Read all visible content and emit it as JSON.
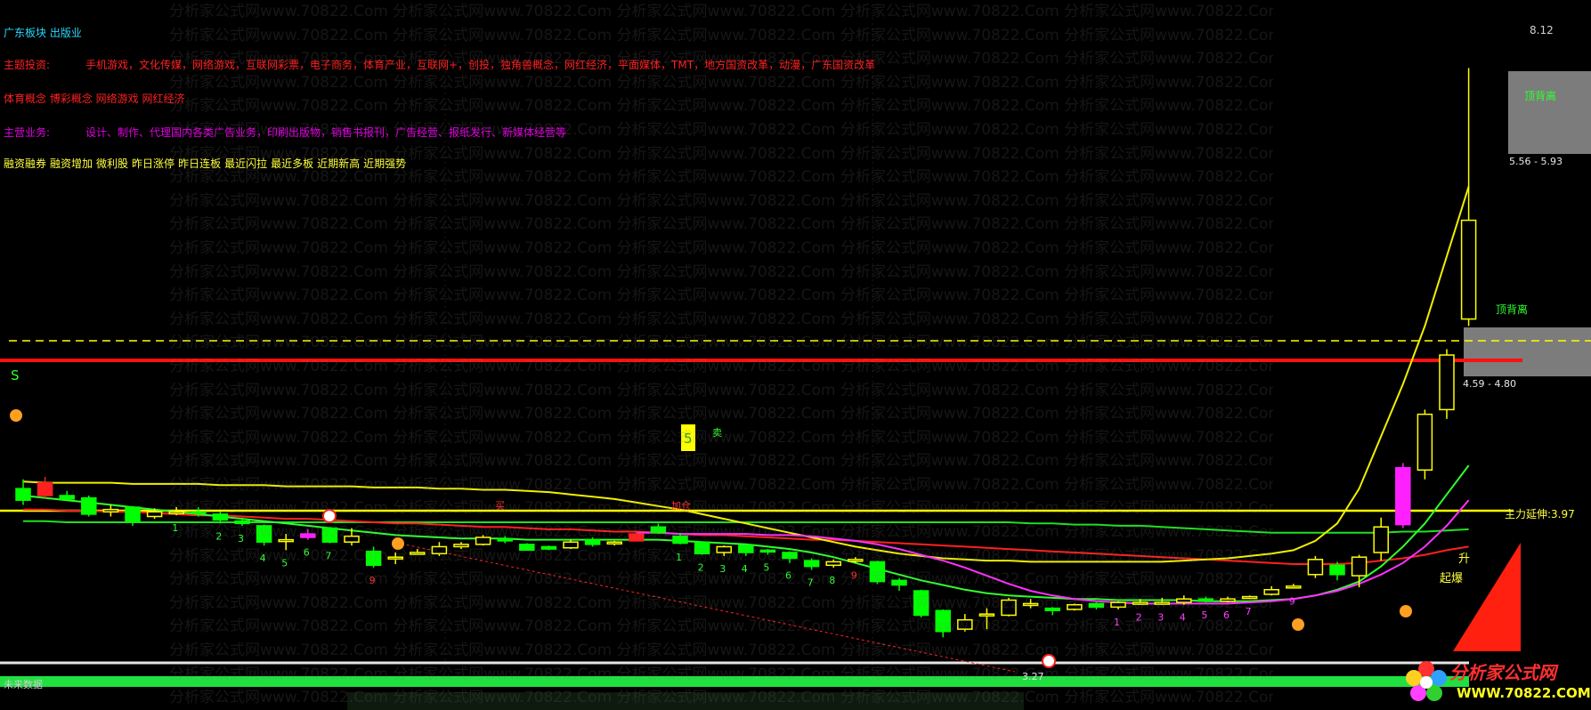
{
  "info": {
    "sector": "广东板块 出版业",
    "theme_key": "主题投资:",
    "theme_val": "手机游戏，文化传媒，网络游戏，互联网彩票，电子商务，体育产业，互联网+，创投，独角兽概念，网红经济，平面媒体，TMT，地方国资改革，动漫，广东国资改革",
    "concept": "体育概念 博彩概念 网络游戏 网红经济",
    "biz_key": "主营业务:",
    "biz_val": "设计、制作、代理国内各类广告业务，印刷出版物，销售书报刊，广告经营、报纸发行、新媒体经营等",
    "tags": [
      "融资融券",
      "融资增加",
      "微利股",
      "昨日涨停",
      "昨日连板",
      "最近闪拉",
      "最近多板",
      "近期新高",
      "近期强势"
    ]
  },
  "watermark": "分析家公式网www.70822.Com",
  "bottom_label": "未来数据",
  "logo": {
    "cn": "分析家公式网",
    "url": "WWW.70822.COM"
  },
  "colors": {
    "up": "#ffff00",
    "down": "#00ff00",
    "bg": "#000000",
    "accent": "#ff2020"
  },
  "chart_data": {
    "type": "candlestick",
    "annotations": {
      "top_price": "8.12",
      "zone_high": "5.56 - 5.93",
      "zone_mid": "4.59 - 4.80",
      "low_price": "3.27",
      "extend": "主力延伸:3.97",
      "divergence1": "顶背离",
      "divergence2": "顶背离",
      "surge": "起爆",
      "rise": "升",
      "buy": "买",
      "sell": "卖",
      "add": "加仓",
      "s_mark": "S",
      "five": "5"
    },
    "counts": [
      {
        "i": 7,
        "t": "1"
      },
      {
        "i": 9,
        "t": "2"
      },
      {
        "i": 10,
        "t": "3"
      },
      {
        "i": 11,
        "t": "4"
      },
      {
        "i": 12,
        "t": "5"
      },
      {
        "i": 13,
        "t": "6"
      },
      {
        "i": 14,
        "t": "7"
      },
      {
        "i": 16,
        "t": "9"
      },
      {
        "i": 30,
        "t": "1"
      },
      {
        "i": 31,
        "t": "2"
      },
      {
        "i": 32,
        "t": "3"
      },
      {
        "i": 33,
        "t": "4"
      },
      {
        "i": 34,
        "t": "5"
      },
      {
        "i": 35,
        "t": "6"
      },
      {
        "i": 36,
        "t": "7"
      },
      {
        "i": 37,
        "t": "8"
      },
      {
        "i": 38,
        "t": "9"
      },
      {
        "i": 50,
        "t": "1"
      },
      {
        "i": 51,
        "t": "2"
      },
      {
        "i": 52,
        "t": "3"
      },
      {
        "i": 53,
        "t": "4"
      },
      {
        "i": 54,
        "t": "5"
      },
      {
        "i": 55,
        "t": "6"
      },
      {
        "i": 56,
        "t": "7"
      },
      {
        "i": 58,
        "t": "9"
      }
    ],
    "candles": [
      {
        "o": 4.5,
        "c": 4.4,
        "h": 4.58,
        "l": 4.36
      },
      {
        "o": 4.55,
        "c": 4.44,
        "h": 4.6,
        "l": 4.42
      },
      {
        "o": 4.44,
        "c": 4.41,
        "h": 4.48,
        "l": 4.4
      },
      {
        "o": 4.42,
        "c": 4.28,
        "h": 4.44,
        "l": 4.26
      },
      {
        "o": 4.3,
        "c": 4.32,
        "h": 4.36,
        "l": 4.26
      },
      {
        "o": 4.34,
        "c": 4.22,
        "h": 4.35,
        "l": 4.18
      },
      {
        "o": 4.26,
        "c": 4.3,
        "h": 4.33,
        "l": 4.24
      },
      {
        "o": 4.3,
        "c": 4.3,
        "h": 4.34,
        "l": 4.27
      },
      {
        "o": 4.3,
        "c": 4.29,
        "h": 4.34,
        "l": 4.26
      },
      {
        "o": 4.28,
        "c": 4.23,
        "h": 4.3,
        "l": 4.2
      },
      {
        "o": 4.22,
        "c": 4.2,
        "h": 4.25,
        "l": 4.18
      },
      {
        "o": 4.18,
        "c": 4.04,
        "h": 4.19,
        "l": 4.01
      },
      {
        "o": 4.06,
        "c": 4.06,
        "h": 4.11,
        "l": 3.97
      },
      {
        "o": 4.08,
        "c": 4.11,
        "h": 4.15,
        "l": 4.06
      },
      {
        "o": 4.16,
        "c": 4.04,
        "h": 4.17,
        "l": 4.03
      },
      {
        "o": 4.04,
        "c": 4.09,
        "h": 4.16,
        "l": 4.01
      },
      {
        "o": 3.96,
        "c": 3.84,
        "h": 4.0,
        "l": 3.82
      },
      {
        "o": 3.91,
        "c": 3.91,
        "h": 3.95,
        "l": 3.85
      },
      {
        "o": 3.95,
        "c": 3.95,
        "h": 3.98,
        "l": 3.94
      },
      {
        "o": 3.94,
        "c": 4.0,
        "h": 4.04,
        "l": 3.92
      },
      {
        "o": 4.0,
        "c": 4.02,
        "h": 4.04,
        "l": 3.98
      },
      {
        "o": 4.02,
        "c": 4.08,
        "h": 4.1,
        "l": 4.01
      },
      {
        "o": 4.07,
        "c": 4.05,
        "h": 4.09,
        "l": 4.03
      },
      {
        "o": 4.02,
        "c": 3.97,
        "h": 4.03,
        "l": 3.97
      },
      {
        "o": 4.0,
        "c": 3.98,
        "h": 4.01,
        "l": 3.97
      },
      {
        "o": 3.99,
        "c": 4.04,
        "h": 4.06,
        "l": 3.98
      },
      {
        "o": 4.06,
        "c": 4.02,
        "h": 4.08,
        "l": 4.0
      },
      {
        "o": 4.03,
        "c": 4.04,
        "h": 4.05,
        "l": 4.01
      },
      {
        "o": 4.05,
        "c": 4.11,
        "h": 4.13,
        "l": 4.05
      },
      {
        "o": 4.17,
        "c": 4.12,
        "h": 4.2,
        "l": 4.11
      },
      {
        "o": 4.09,
        "c": 4.03,
        "h": 4.12,
        "l": 4.02
      },
      {
        "o": 4.04,
        "c": 3.94,
        "h": 4.04,
        "l": 3.93
      },
      {
        "o": 3.95,
        "c": 4.0,
        "h": 4.01,
        "l": 3.92
      },
      {
        "o": 4.01,
        "c": 3.95,
        "h": 4.01,
        "l": 3.92
      },
      {
        "o": 3.97,
        "c": 3.96,
        "h": 3.98,
        "l": 3.93
      },
      {
        "o": 3.95,
        "c": 3.9,
        "h": 3.96,
        "l": 3.86
      },
      {
        "o": 3.88,
        "c": 3.83,
        "h": 3.9,
        "l": 3.8
      },
      {
        "o": 3.84,
        "c": 3.87,
        "h": 3.89,
        "l": 3.82
      },
      {
        "o": 3.88,
        "c": 3.89,
        "h": 3.91,
        "l": 3.86
      },
      {
        "o": 3.87,
        "c": 3.7,
        "h": 3.88,
        "l": 3.68
      },
      {
        "o": 3.71,
        "c": 3.67,
        "h": 3.73,
        "l": 3.62
      },
      {
        "o": 3.62,
        "c": 3.41,
        "h": 3.63,
        "l": 3.39
      },
      {
        "o": 3.45,
        "c": 3.27,
        "h": 3.46,
        "l": 3.22
      },
      {
        "o": 3.29,
        "c": 3.37,
        "h": 3.42,
        "l": 3.27
      },
      {
        "o": 3.42,
        "c": 3.42,
        "h": 3.47,
        "l": 3.29
      },
      {
        "o": 3.41,
        "c": 3.54,
        "h": 3.56,
        "l": 3.4
      },
      {
        "o": 3.51,
        "c": 3.51,
        "h": 3.55,
        "l": 3.47
      },
      {
        "o": 3.47,
        "c": 3.45,
        "h": 3.48,
        "l": 3.41
      },
      {
        "o": 3.46,
        "c": 3.5,
        "h": 3.51,
        "l": 3.45
      },
      {
        "o": 3.51,
        "c": 3.48,
        "h": 3.52,
        "l": 3.46
      },
      {
        "o": 3.48,
        "c": 3.52,
        "h": 3.53,
        "l": 3.46
      },
      {
        "o": 3.51,
        "c": 3.52,
        "h": 3.55,
        "l": 3.5
      },
      {
        "o": 3.52,
        "c": 3.52,
        "h": 3.56,
        "l": 3.5
      },
      {
        "o": 3.52,
        "c": 3.55,
        "h": 3.58,
        "l": 3.5
      },
      {
        "o": 3.55,
        "c": 3.53,
        "h": 3.57,
        "l": 3.52
      },
      {
        "o": 3.53,
        "c": 3.55,
        "h": 3.57,
        "l": 3.52
      },
      {
        "o": 3.56,
        "c": 3.57,
        "h": 3.58,
        "l": 3.55
      },
      {
        "o": 3.59,
        "c": 3.63,
        "h": 3.66,
        "l": 3.58
      },
      {
        "o": 3.65,
        "c": 3.66,
        "h": 3.68,
        "l": 3.64
      },
      {
        "o": 3.76,
        "c": 3.89,
        "h": 3.92,
        "l": 3.73
      },
      {
        "o": 3.84,
        "c": 3.76,
        "h": 3.87,
        "l": 3.71
      },
      {
        "o": 3.75,
        "c": 3.91,
        "h": 3.93,
        "l": 3.65
      },
      {
        "o": 3.95,
        "c": 4.17,
        "h": 4.25,
        "l": 3.88
      },
      {
        "o": 4.19,
        "c": 4.68,
        "h": 4.72,
        "l": 4.16
      },
      {
        "o": 4.66,
        "c": 5.14,
        "h": 5.18,
        "l": 4.58
      },
      {
        "o": 5.18,
        "c": 5.65,
        "h": 5.7,
        "l": 5.1
      },
      {
        "o": 5.96,
        "c": 6.81,
        "h": 8.12,
        "l": 5.9
      }
    ],
    "ma_green": [
      4.22,
      4.22,
      4.21,
      4.21,
      4.21,
      4.21,
      4.21,
      4.21,
      4.21,
      4.21,
      4.21,
      4.21,
      4.21,
      4.21,
      4.21,
      4.21,
      4.21,
      4.21,
      4.21,
      4.21,
      4.21,
      4.21,
      4.21,
      4.21,
      4.21,
      4.21,
      4.21,
      4.21,
      4.21,
      4.21,
      4.21,
      4.21,
      4.21,
      4.21,
      4.21,
      4.21,
      4.21,
      4.21,
      4.21,
      4.21,
      4.21,
      4.21,
      4.21,
      4.21,
      4.21,
      4.21,
      4.2,
      4.2,
      4.19,
      4.19,
      4.18,
      4.18,
      4.17,
      4.16,
      4.15,
      4.14,
      4.13,
      4.12,
      4.12,
      4.12,
      4.12,
      4.12,
      4.12,
      4.13,
      4.13,
      4.14,
      4.15
    ],
    "ma_red": [
      4.32,
      4.32,
      4.31,
      4.31,
      4.3,
      4.3,
      4.29,
      4.28,
      4.27,
      4.27,
      4.26,
      4.25,
      4.24,
      4.24,
      4.23,
      4.22,
      4.21,
      4.2,
      4.2,
      4.19,
      4.18,
      4.17,
      4.17,
      4.16,
      4.15,
      4.15,
      4.14,
      4.13,
      4.13,
      4.12,
      4.11,
      4.1,
      4.1,
      4.09,
      4.08,
      4.07,
      4.06,
      4.06,
      4.05,
      4.04,
      4.03,
      4.02,
      4.01,
      4.0,
      3.99,
      3.98,
      3.97,
      3.96,
      3.95,
      3.94,
      3.93,
      3.92,
      3.91,
      3.9,
      3.89,
      3.88,
      3.87,
      3.86,
      3.85,
      3.85,
      3.85,
      3.86,
      3.88,
      3.9,
      3.93,
      3.97,
      4.0
    ],
    "ma_yellow": [
      4.56,
      4.55,
      4.55,
      4.55,
      4.55,
      4.54,
      4.54,
      4.54,
      4.54,
      4.53,
      4.53,
      4.53,
      4.52,
      4.52,
      4.52,
      4.52,
      4.51,
      4.51,
      4.51,
      4.5,
      4.5,
      4.49,
      4.49,
      4.48,
      4.47,
      4.45,
      4.43,
      4.41,
      4.38,
      4.35,
      4.32,
      4.28,
      4.24,
      4.2,
      4.16,
      4.12,
      4.08,
      4.04,
      4.0,
      3.97,
      3.94,
      3.92,
      3.9,
      3.89,
      3.88,
      3.88,
      3.87,
      3.87,
      3.87,
      3.87,
      3.87,
      3.87,
      3.87,
      3.88,
      3.89,
      3.9,
      3.92,
      3.94,
      3.97,
      4.05,
      4.2,
      4.5,
      4.95,
      5.4,
      5.9,
      6.5,
      7.1
    ],
    "ma_green2": [
      4.44,
      4.42,
      4.4,
      4.38,
      4.36,
      4.34,
      4.32,
      4.3,
      4.28,
      4.26,
      4.24,
      4.22,
      4.2,
      4.18,
      4.16,
      4.14,
      4.12,
      4.1,
      4.09,
      4.08,
      4.07,
      4.07,
      4.07,
      4.06,
      4.06,
      4.06,
      4.06,
      4.06,
      4.06,
      4.06,
      4.05,
      4.04,
      4.03,
      4.02,
      4.0,
      3.98,
      3.95,
      3.91,
      3.86,
      3.81,
      3.76,
      3.71,
      3.67,
      3.63,
      3.6,
      3.58,
      3.57,
      3.56,
      3.55,
      3.55,
      3.54,
      3.54,
      3.54,
      3.54,
      3.53,
      3.53,
      3.53,
      3.54,
      3.55,
      3.58,
      3.63,
      3.7,
      3.83,
      4.0,
      4.2,
      4.45,
      4.7
    ],
    "ma_magenta": [
      null,
      null,
      null,
      null,
      null,
      null,
      null,
      null,
      null,
      null,
      null,
      null,
      null,
      null,
      null,
      null,
      null,
      null,
      null,
      null,
      null,
      null,
      null,
      null,
      null,
      null,
      null,
      null,
      4.12,
      4.12,
      4.11,
      4.11,
      4.11,
      4.11,
      4.1,
      4.1,
      4.09,
      4.07,
      4.05,
      4.02,
      3.98,
      3.93,
      3.88,
      3.82,
      3.75,
      3.68,
      3.62,
      3.58,
      3.55,
      3.53,
      3.52,
      3.51,
      3.51,
      3.51,
      3.51,
      3.51,
      3.52,
      3.53,
      3.55,
      3.58,
      3.62,
      3.68,
      3.76,
      3.86,
      4.0,
      4.18,
      4.4
    ],
    "ymin": 3.0,
    "ymax": 8.4
  }
}
